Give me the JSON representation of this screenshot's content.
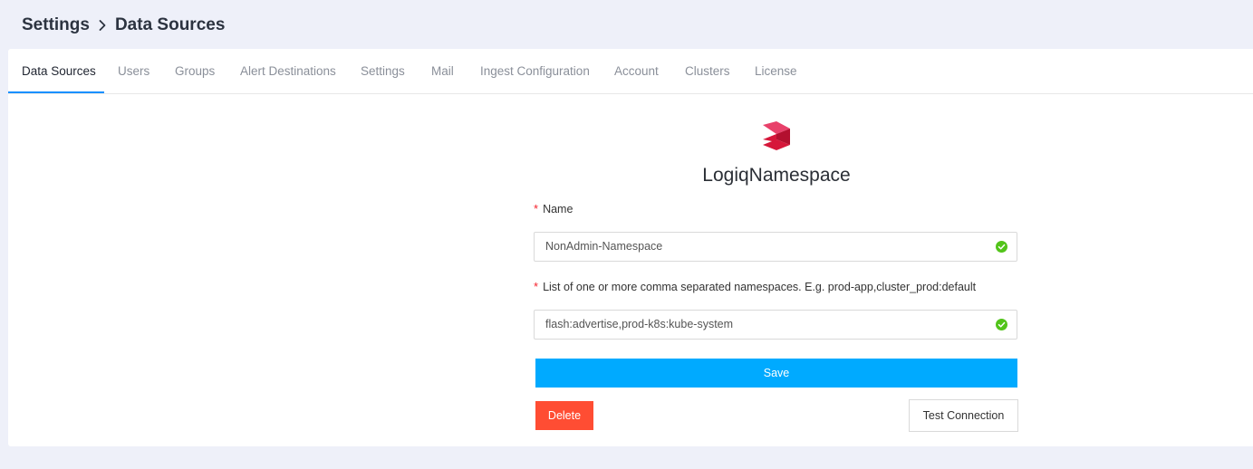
{
  "breadcrumb": {
    "root": "Settings",
    "current": "Data Sources"
  },
  "tabs": [
    {
      "label": "Data Sources",
      "active": true
    },
    {
      "label": "Users"
    },
    {
      "label": "Groups"
    },
    {
      "label": "Alert Destinations"
    },
    {
      "label": "Settings"
    },
    {
      "label": "Mail"
    },
    {
      "label": "Ingest Configuration"
    },
    {
      "label": "Account"
    },
    {
      "label": "Clusters"
    },
    {
      "label": "License"
    }
  ],
  "datasource": {
    "logo_icon": "logiq-logo-icon",
    "title": "LogiqNamespace"
  },
  "form": {
    "required_mark": "*",
    "name_label": "Name",
    "name_value": "NonAdmin-Namespace",
    "namespaces_label": "List of one or more comma separated namespaces. E.g. prod-app,cluster_prod:default",
    "namespaces_value": "flash:advertise,prod-k8s:kube-system",
    "valid_icon": "check-circle-icon"
  },
  "buttons": {
    "save": "Save",
    "delete": "Delete",
    "test": "Test Connection"
  },
  "colors": {
    "accent": "#1890ff",
    "save_bg": "#00aaff",
    "delete_bg": "#ff4d33",
    "success": "#52c41a",
    "logo": "#d6173a"
  }
}
